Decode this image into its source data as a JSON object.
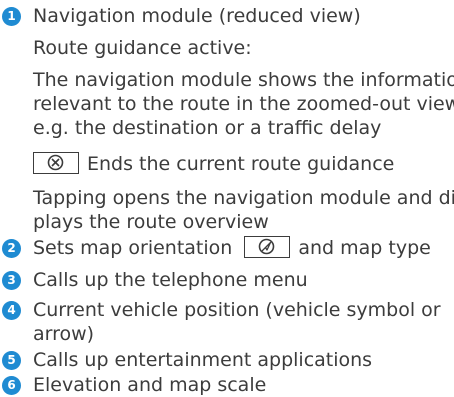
{
  "accent": "#1f8bd2",
  "items": [
    {
      "number": "1",
      "label": "Navigation module (reduced view)"
    },
    {
      "number": "2",
      "before": "Sets map orientation",
      "icon": "compass-arrow-icon",
      "after": "and map type"
    },
    {
      "number": "3",
      "label": "Calls up the telephone menu"
    },
    {
      "number": "4",
      "lines": [
        "Current vehicle position (vehicle symbol or",
        "arrow)"
      ]
    },
    {
      "number": "5",
      "label": "Calls up entertainment applications"
    },
    {
      "number": "6",
      "label": "Elevation and map scale"
    }
  ],
  "sub": {
    "route_active": "Route guidance active:",
    "desc_lines": [
      "The navigation module shows the information",
      "relevant to the route in the zoomed-out view,",
      "e.g. the destination or a traffic delay"
    ],
    "end_icon": "close-circle-icon",
    "end_text": "Ends the current route guidance",
    "tap_lines": [
      "Tapping opens the navigation module and dis-",
      "plays the route overview"
    ]
  }
}
